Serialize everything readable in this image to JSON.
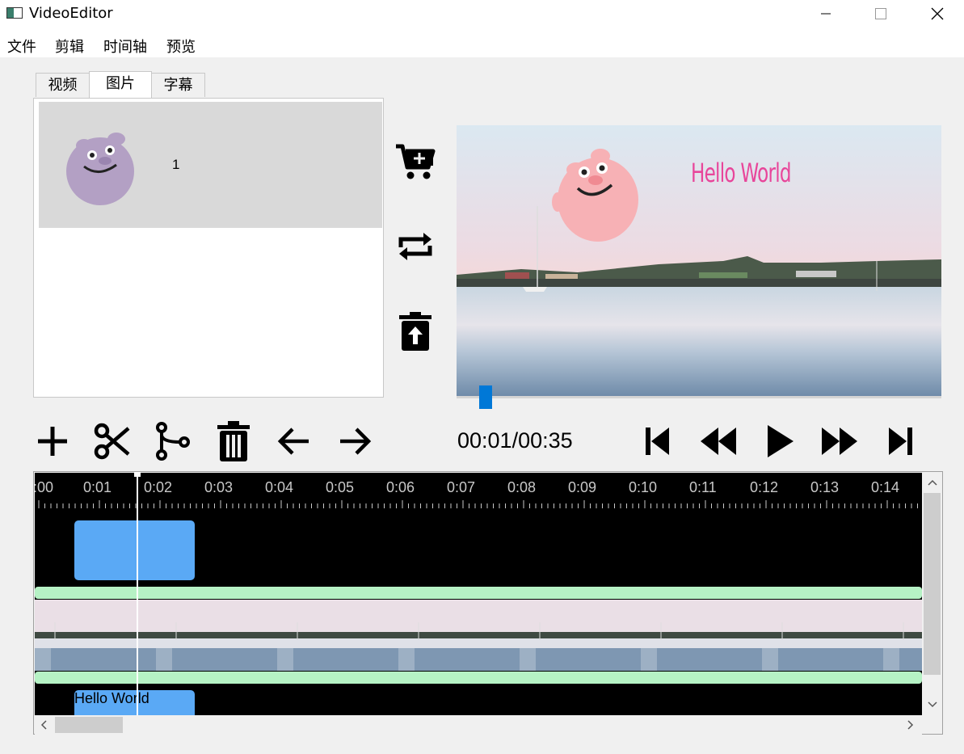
{
  "window": {
    "title": "VideoEditor",
    "controls": [
      "minimize",
      "maximize",
      "close"
    ]
  },
  "menu": [
    "文件",
    "剪辑",
    "时间轴",
    "预览"
  ],
  "tabs": [
    {
      "label": "视频",
      "active": false
    },
    {
      "label": "图片",
      "active": true
    },
    {
      "label": "字幕",
      "active": false
    }
  ],
  "media_list": {
    "items": [
      {
        "label": "1",
        "thumbnail": "pig-sticker"
      }
    ]
  },
  "side_actions": [
    {
      "icon": "cart-add-icon"
    },
    {
      "icon": "replace-icon"
    },
    {
      "icon": "trash-restore-icon"
    }
  ],
  "preview": {
    "overlay_text": "Hello World",
    "overlay_color": "#e8459a",
    "progress": 0.05
  },
  "toolbar": {
    "edit_tools": [
      "add-icon",
      "cut-icon",
      "split-icon",
      "delete-icon",
      "arrow-left-icon",
      "arrow-right-icon"
    ],
    "time_display": "00:01/00:35",
    "playback": [
      "skip-start-icon",
      "rewind-icon",
      "play-icon",
      "fast-forward-icon",
      "skip-end-icon"
    ]
  },
  "timeline": {
    "ticks": [
      ":00",
      "0:01",
      "0:02",
      "0:03",
      "0:04",
      "0:05",
      "0:06",
      "0:07",
      "0:08",
      "0:09",
      "0:10",
      "0:11",
      "0:12",
      "0:13",
      "0:14"
    ],
    "playhead_seconds": 1.6,
    "image_clip": {
      "start": 0.65,
      "end": 2.65
    },
    "subtitle_clip": {
      "text": "Hello World",
      "start": 0.65,
      "end": 2.65
    },
    "clip_color": "#5aa9f5",
    "track_bar_color": "#b6f2c5"
  }
}
